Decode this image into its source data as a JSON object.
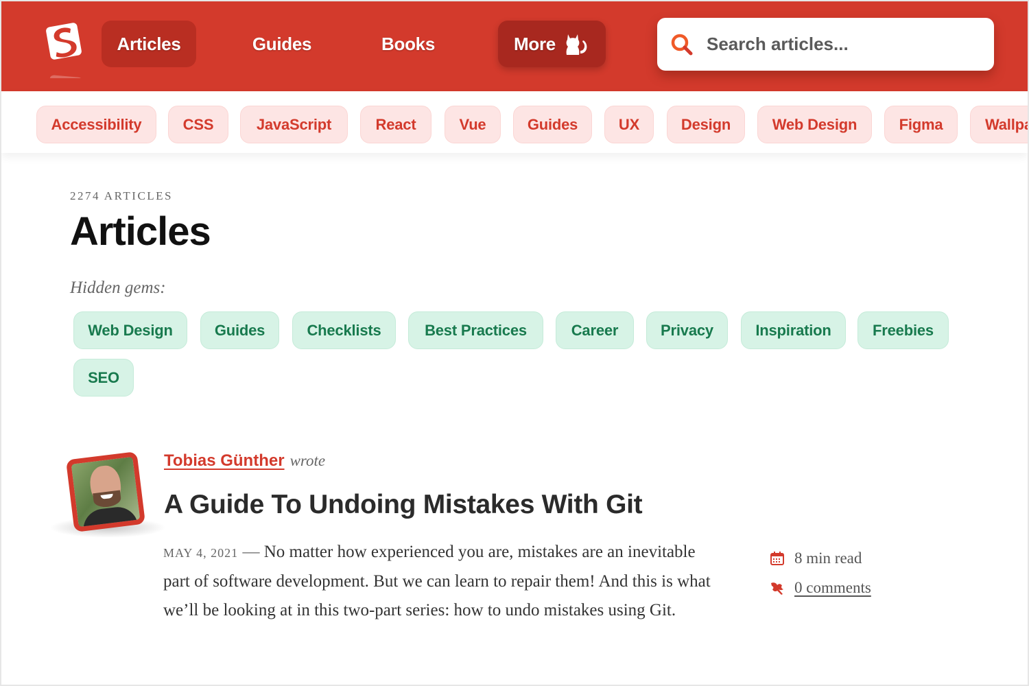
{
  "header": {
    "logo_alt": "Smashing Magazine logo",
    "nav": [
      {
        "label": "Articles",
        "active": true
      },
      {
        "label": "Guides",
        "active": false
      },
      {
        "label": "Books",
        "active": false
      },
      {
        "label": "More",
        "active": false,
        "icon": "cat-icon"
      }
    ],
    "search": {
      "placeholder": "Search articles...",
      "value": "",
      "icon": "search-icon"
    }
  },
  "topics": [
    "Accessibility",
    "CSS",
    "JavaScript",
    "React",
    "Vue",
    "Guides",
    "UX",
    "Design",
    "Web Design",
    "Figma",
    "Wallpa"
  ],
  "main": {
    "count_label": "2274 ARTICLES",
    "title": "Articles",
    "hidden_gems_label": "Hidden gems:",
    "hidden_gems": [
      "Web Design",
      "Guides",
      "Checklists",
      "Best Practices",
      "Career",
      "Privacy",
      "Inspiration",
      "Freebies",
      "SEO"
    ]
  },
  "article": {
    "author": "Tobias Günther",
    "wrote": "wrote",
    "title": "A Guide To Undoing Mistakes With Git",
    "date": "MAY 4, 2021",
    "dash": "—",
    "summary": "No matter how experienced you are, mistakes are an inevitable part of software development. But we can learn to repair them! And this is what we’ll be looking at in this two-part series: how to undo mistakes using Git.",
    "read_time": "8 min read",
    "comments": "0 comments"
  },
  "colors": {
    "brand_red": "#d33a2c",
    "topic_bg": "#fde5e4",
    "gem_bg": "#d7f3e6",
    "gem_text": "#187a4e"
  }
}
